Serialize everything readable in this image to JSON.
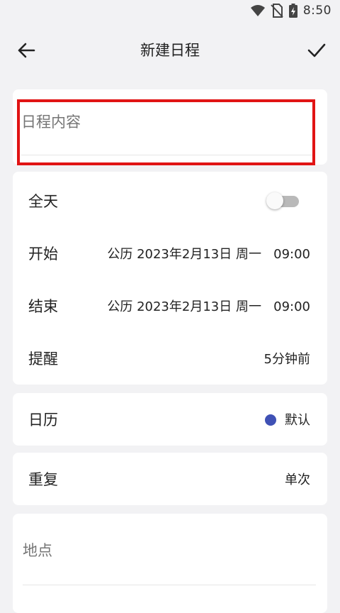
{
  "status": {
    "time": "8:50"
  },
  "appbar": {
    "title": "新建日程"
  },
  "content": {
    "placeholder": "日程内容"
  },
  "allday": {
    "label": "全天",
    "enabled": false
  },
  "start": {
    "label": "开始",
    "value": "公历 2023年2月13日 周一   09:00"
  },
  "end": {
    "label": "结束",
    "value": "公历 2023年2月13日 周一   09:00"
  },
  "reminder": {
    "label": "提醒",
    "value": "5分钟前"
  },
  "calendar": {
    "label": "日历",
    "value": "默认",
    "color": "#3f51b5"
  },
  "repeat": {
    "label": "重复",
    "value": "单次"
  },
  "location": {
    "placeholder": "地点"
  }
}
